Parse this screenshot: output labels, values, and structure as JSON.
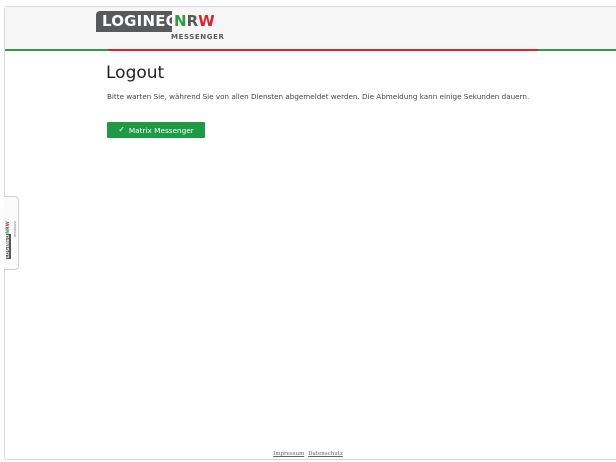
{
  "logo": {
    "part1": "LOGINEO",
    "n": "N",
    "r": "R",
    "w": "W",
    "subtitle": "MESSENGER"
  },
  "main": {
    "title": "Logout",
    "description": "Bitte warten Sie, während Sie von allen Diensten abgemeldet werden. Die Abmeldung kann einige Sekunden dauern.",
    "button_label": "Matrix Messenger",
    "button_icon": "check-icon"
  },
  "sidetab": {
    "logo_part1": "LOGINEO",
    "n": "N",
    "r": "R",
    "w": "W",
    "subtitle": "MESSENGER"
  },
  "footer": {
    "links": [
      "Impressum",
      "Datenschutz"
    ]
  },
  "colors": {
    "green": "#2e9b47",
    "red": "#d5272e",
    "gray": "#58595b",
    "button": "#1e9a45"
  }
}
